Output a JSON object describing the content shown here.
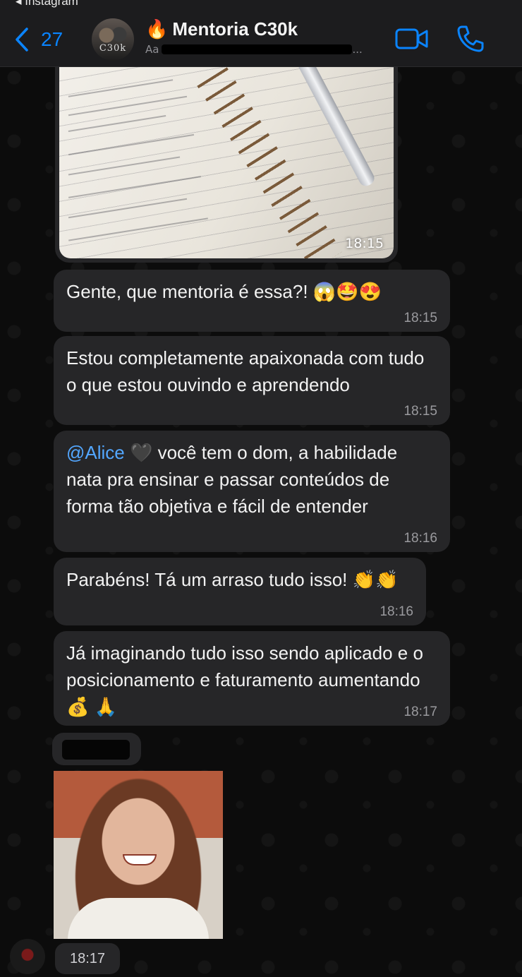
{
  "status_bar": {
    "back_app": "◂ Instagram"
  },
  "header": {
    "back_count": "27",
    "avatar_text": "C30k",
    "title_emoji": "🔥",
    "title": "Mentoria C30k",
    "subtitle_visible": "Aa",
    "subtitle_suffix": "...",
    "icons": [
      "chevron-left-icon",
      "video-call-icon",
      "phone-call-icon"
    ],
    "accent_color": "#0a84ff"
  },
  "messages": [
    {
      "type": "image",
      "time": "18:15"
    },
    {
      "type": "text",
      "text": "Gente, que mentoria é essa?! 😱🤩😍",
      "time": "18:15"
    },
    {
      "type": "text",
      "text": "Estou completamente apaixonada com tudo o que estou ouvindo e aprendendo",
      "time": "18:15"
    },
    {
      "type": "text",
      "mention": "@Alice",
      "text": " 🖤 você tem o dom, a habilidade nata pra ensinar e passar conteúdos de forma tão objetiva e fácil de entender",
      "time": "18:16"
    },
    {
      "type": "text",
      "text": "Parabéns! Tá um arraso tudo isso! 👏👏",
      "time": "18:16"
    },
    {
      "type": "text",
      "text": "Já imaginando tudo isso sendo aplicado e o posicionamento e faturamento aumentando 💰 🙏",
      "time": "18:17"
    },
    {
      "type": "photo",
      "time": "18:17"
    }
  ]
}
